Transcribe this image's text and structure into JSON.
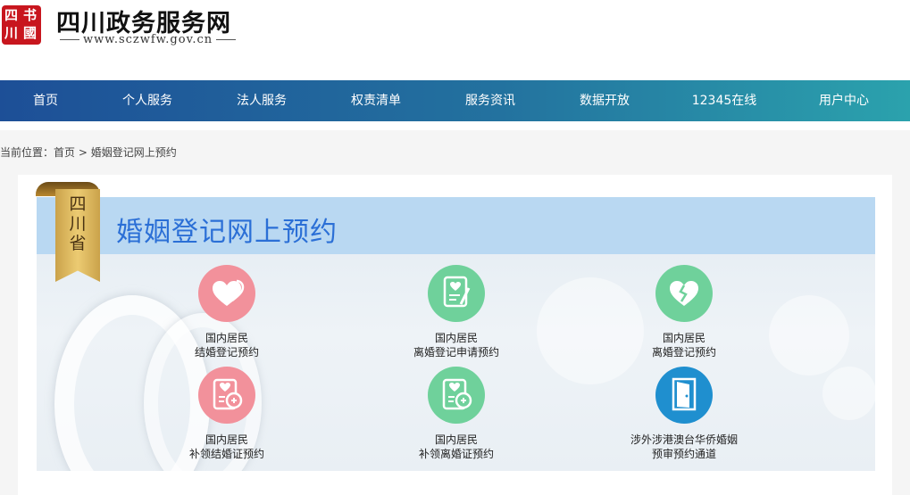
{
  "header": {
    "logo_glyphs": [
      "四",
      "书",
      "川",
      "國"
    ],
    "site_title": "四川政务服务网",
    "site_url": "www.sczwfw.gov.cn"
  },
  "nav": {
    "items": [
      {
        "label": "首页"
      },
      {
        "label": "个人服务"
      },
      {
        "label": "法人服务"
      },
      {
        "label": "权责清单"
      },
      {
        "label": "服务资讯"
      },
      {
        "label": "数据开放"
      },
      {
        "label": "12345在线"
      },
      {
        "label": "用户中心"
      }
    ]
  },
  "breadcrumb": {
    "prefix": "当前位置：",
    "home": "首页",
    "separator": ">",
    "current": "婚姻登记网上预约"
  },
  "banner": {
    "ribbon_text": "四川省",
    "title": "婚姻登记网上预约"
  },
  "services": [
    {
      "line1": "国内居民",
      "line2": "结婚登记预约",
      "icon": "hearts-icon",
      "color": "#f2919b"
    },
    {
      "line1": "国内居民",
      "line2": "离婚登记申请预约",
      "icon": "document-heart-icon",
      "color": "#6fd19b"
    },
    {
      "line1": "国内居民",
      "line2": "离婚登记预约",
      "icon": "broken-heart-icon",
      "color": "#6fd19b"
    },
    {
      "line1": "国内居民",
      "line2": "补领结婚证预约",
      "icon": "certificate-reissue-icon",
      "color": "#f2919b"
    },
    {
      "line1": "国内居民",
      "line2": "补领离婚证预约",
      "icon": "certificate-reissue-icon",
      "color": "#6fd19b"
    },
    {
      "line1": "涉外涉港澳台华侨婚姻",
      "line2": "预审预约通道",
      "icon": "door-icon",
      "color": "#1f8fcf"
    }
  ]
}
